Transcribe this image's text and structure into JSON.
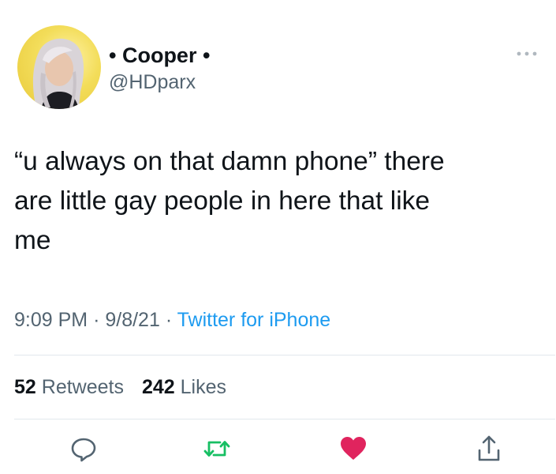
{
  "tweet": {
    "display_name": "• Cooper •",
    "handle": "@HDparx",
    "text": "“u always on that damn phone” there\nare little gay people in here that like\nme",
    "time": "9:09 PM",
    "date": "9/8/21",
    "separator": "·",
    "source": "Twitter for iPhone",
    "retweets_count": "52",
    "retweets_label": "Retweets",
    "likes_count": "242",
    "likes_label": "Likes"
  },
  "icons": {
    "avatar": "avatar-photo",
    "more": "more-dots-icon",
    "reply": "reply-icon",
    "retweet": "retweet-icon",
    "like": "heart-icon",
    "share": "share-icon"
  },
  "colors": {
    "link": "#1d9bf0",
    "retweet": "#17bf63",
    "like": "#e0245e",
    "secondary_text": "#536471",
    "primary_text": "#0f1419"
  }
}
